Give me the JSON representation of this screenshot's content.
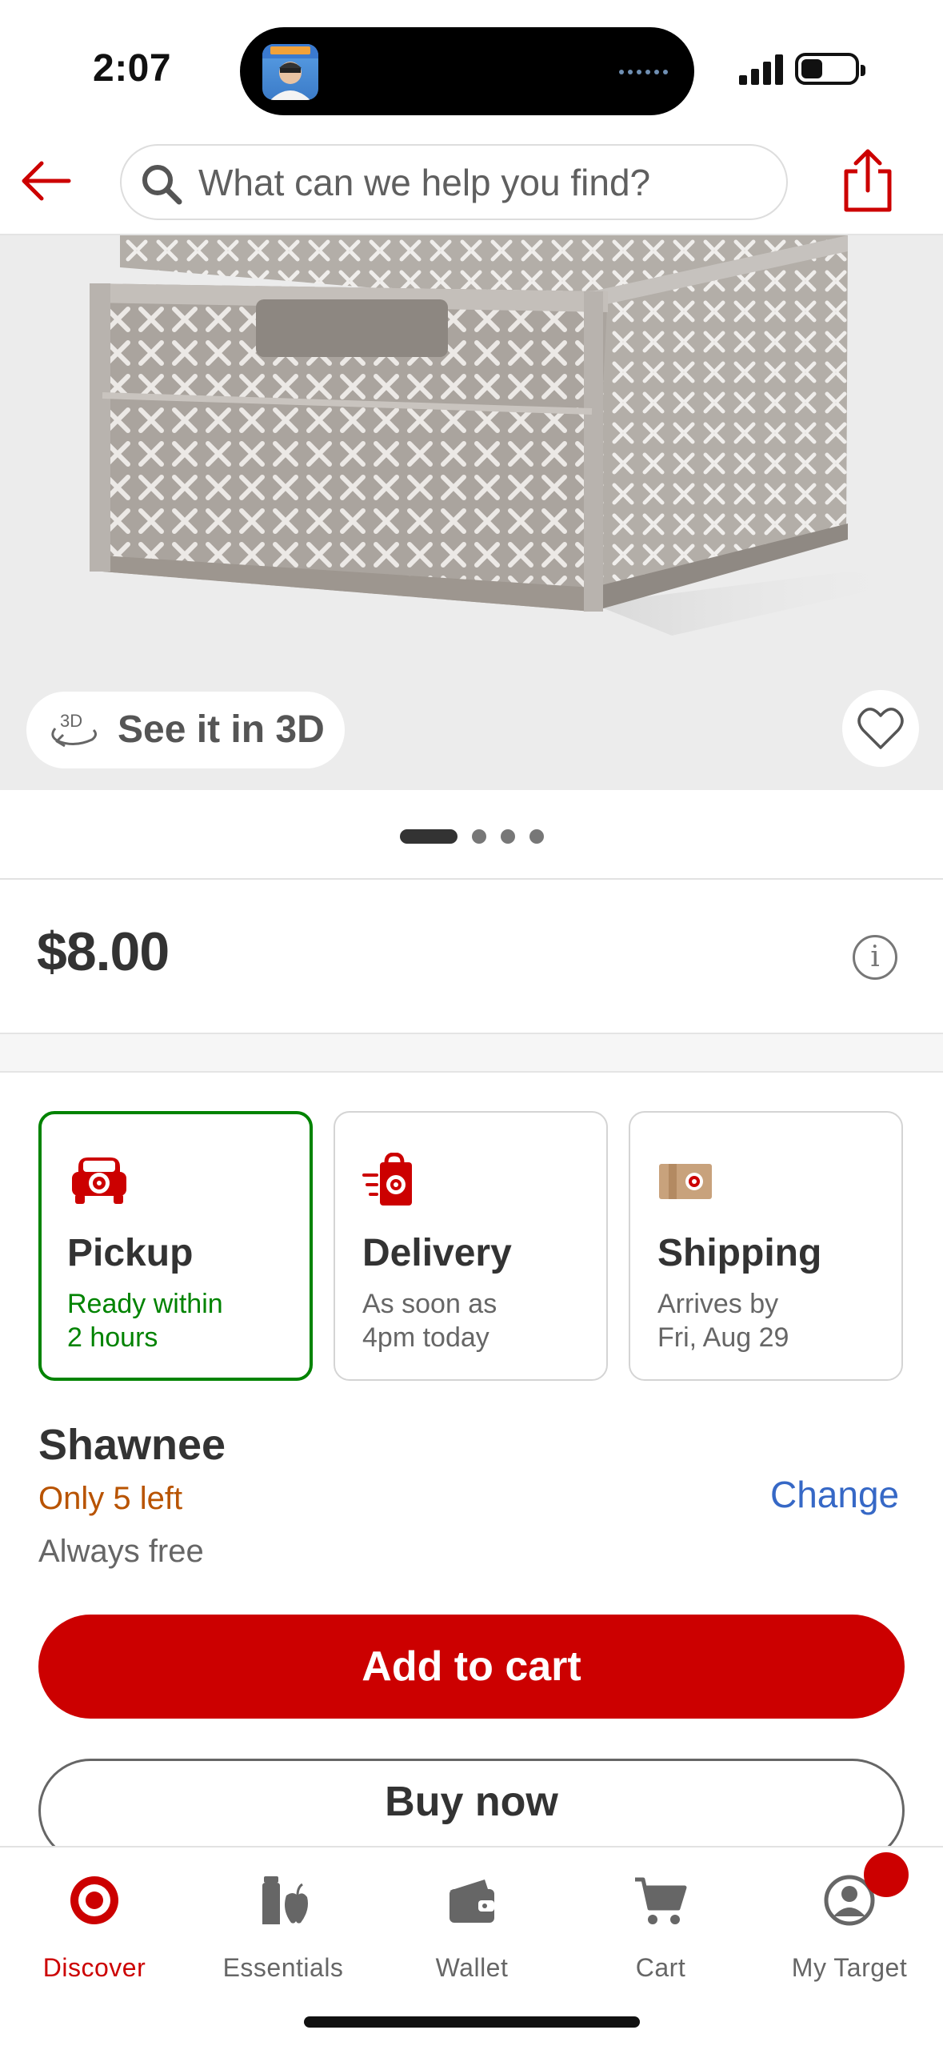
{
  "status_bar": {
    "time": "2:07"
  },
  "header": {
    "search": {
      "placeholder": "What can we help you find?",
      "value": ""
    }
  },
  "gallery": {
    "see_in_3d_label": "See it in 3D",
    "three_d_badge": "3D",
    "slide_count": 4,
    "active_slide": 1
  },
  "price": {
    "value": "$8.00"
  },
  "fulfillment": {
    "options": [
      {
        "title": "Pickup",
        "line1": "Ready within",
        "line2": "2 hours",
        "selected": true
      },
      {
        "title": "Delivery",
        "line1": "As soon as",
        "line2": "4pm today",
        "selected": false
      },
      {
        "title": "Shipping",
        "line1": "Arrives by",
        "line2": "Fri, Aug 29",
        "selected": false
      }
    ],
    "store": "Shawnee",
    "stock": "Only 5 left",
    "change_label": "Change",
    "fee_note": "Always free"
  },
  "actions": {
    "add_to_cart": "Add to cart",
    "buy_now": "Buy now"
  },
  "tabbar": {
    "items": [
      {
        "label": "Discover",
        "icon": "target-bullseye-icon",
        "active": true
      },
      {
        "label": "Essentials",
        "icon": "essentials-icon",
        "active": false
      },
      {
        "label": "Wallet",
        "icon": "wallet-icon",
        "active": false
      },
      {
        "label": "Cart",
        "icon": "cart-icon",
        "active": false
      },
      {
        "label": "My Target",
        "icon": "profile-icon",
        "active": false,
        "has_badge": true
      }
    ]
  },
  "colors": {
    "brand_red": "#cc0000",
    "pickup_green": "#008300",
    "stock_orange": "#b85300",
    "link_blue": "#3668c6"
  }
}
